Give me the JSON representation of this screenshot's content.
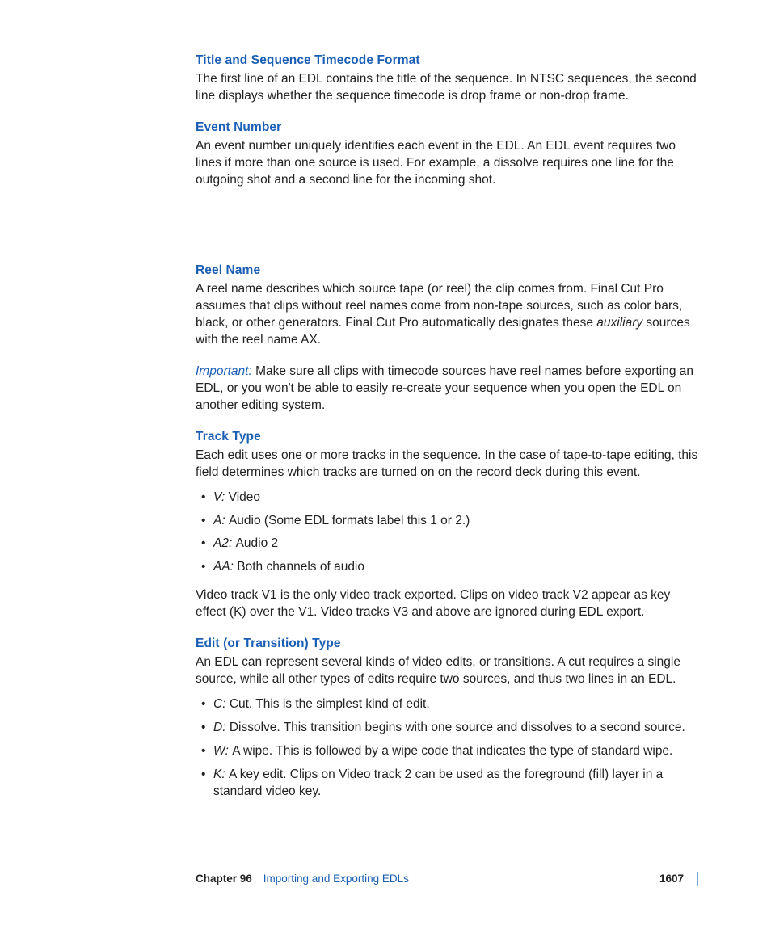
{
  "sections": {
    "s1": {
      "head": "Title and Sequence Timecode Format",
      "body": "The first line of an EDL contains the title of the sequence. In NTSC sequences, the second line displays whether the sequence timecode is drop frame or non-drop frame."
    },
    "s2": {
      "head": "Event Number",
      "body": "An event number uniquely identifies each event in the EDL. An EDL event requires two lines if more than one source is used. For example, a dissolve requires one line for the outgoing shot and a second line for the incoming shot."
    },
    "s3": {
      "head": "Reel Name",
      "body_a": "A reel name describes which source tape (or reel) the clip comes from. Final Cut Pro assumes that clips without reel names come from non-tape sources, such as color bars, black, or other generators. Final Cut Pro automatically designates these ",
      "aux": "auxiliary",
      "body_b": " sources with the reel name AX.",
      "important_label": "Important:  ",
      "important_body": "Make sure all clips with timecode sources have reel names before exporting an EDL, or you won't be able to easily re-create your sequence when you open the EDL on another editing system."
    },
    "s4": {
      "head": "Track Type",
      "body": "Each edit uses one or more tracks in the sequence. In the case of tape-to-tape editing, this field determines which tracks are turned on on the record deck during this event.",
      "items": [
        {
          "term": "V:  ",
          "desc": "Video"
        },
        {
          "term": "A:  ",
          "desc": "Audio (Some EDL formats label this 1 or 2.)"
        },
        {
          "term": "A2:  ",
          "desc": "Audio 2"
        },
        {
          "term": "AA:  ",
          "desc": "Both channels of audio"
        }
      ],
      "after": "Video track V1 is the only video track exported. Clips on video track V2 appear as key effect (K) over the V1. Video tracks V3 and above are ignored during EDL export."
    },
    "s5": {
      "head": "Edit (or Transition) Type",
      "body": "An EDL can represent several kinds of video edits, or transitions. A cut requires a single source, while all other types of edits require two sources, and thus two lines in an EDL.",
      "items": [
        {
          "term": "C:  ",
          "desc": "Cut. This is the simplest kind of edit."
        },
        {
          "term": "D:  ",
          "desc": "Dissolve. This transition begins with one source and dissolves to a second source."
        },
        {
          "term": "W:  ",
          "desc": "A wipe. This is followed by a wipe code that indicates the type of standard wipe."
        },
        {
          "term": "K:  ",
          "desc": "A key edit. Clips on Video track 2 can be used as the foreground (fill) layer in a standard video key."
        }
      ]
    }
  },
  "footer": {
    "chapter": "Chapter 96",
    "title": "Importing and Exporting EDLs",
    "page": "1607"
  }
}
